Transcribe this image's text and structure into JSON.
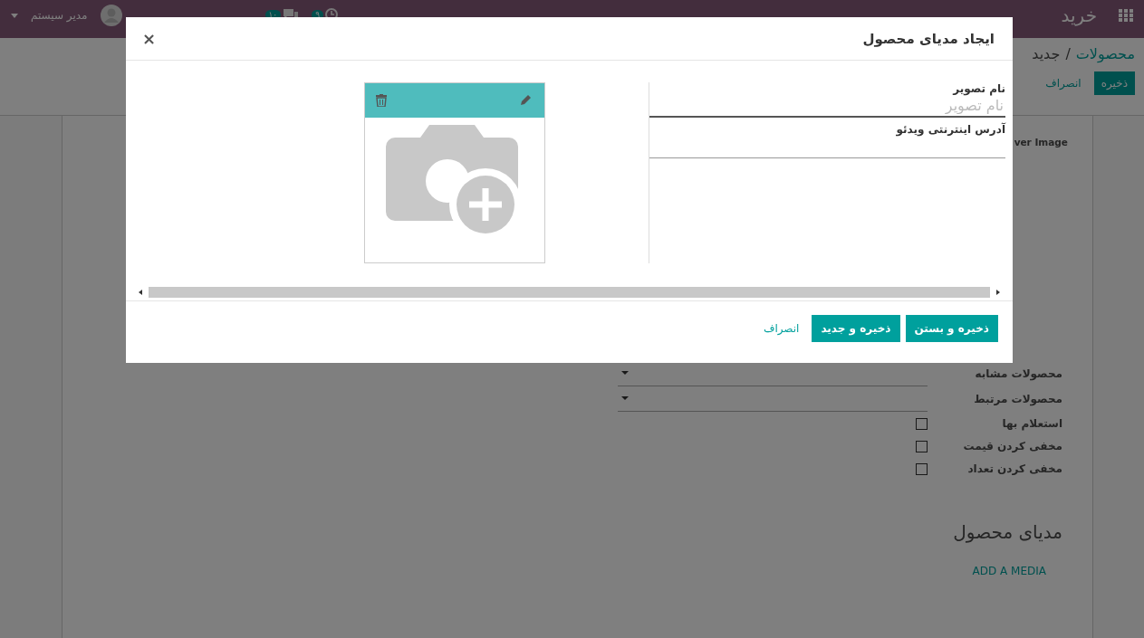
{
  "navbar": {
    "app_name": "خرید",
    "activities_badge": "۹",
    "messages_badge": "۱۰",
    "user": "مدیر سیستم"
  },
  "breadcrumb": {
    "parent": "محصولات",
    "separator": "/",
    "current": "جدید"
  },
  "control_buttons": [
    {
      "label": "ذخیره",
      "kind": "primary"
    },
    {
      "label": "انصراف",
      "kind": "link"
    }
  ],
  "form": {
    "cut_label": "ver Image",
    "fields": [
      {
        "label": "محصولات مشابه",
        "kind": "select"
      },
      {
        "label": "محصولات مرتبط",
        "kind": "select"
      },
      {
        "label": "استعلام بها",
        "kind": "checkbox",
        "checked": false
      },
      {
        "label": "مخفی کردن قیمت",
        "kind": "checkbox",
        "checked": false
      },
      {
        "label": "مخفی کردن تعداد",
        "kind": "checkbox",
        "checked": false
      }
    ],
    "media_heading": "مدیای محصول",
    "add_media": "ADD A MEDIA"
  },
  "dialog": {
    "title": "ایجاد مدیای محصول",
    "close": "×",
    "fields": [
      {
        "label": "نام تصویر",
        "placeholder": "نام تصویر"
      },
      {
        "label": "آدرس اینترنتی ویدئو"
      }
    ],
    "buttons": [
      {
        "label": "ذخیره و بستن",
        "kind": "primary"
      },
      {
        "label": "ذخیره و جدید",
        "kind": "primary"
      },
      {
        "label": "انصراف",
        "kind": "link"
      }
    ]
  }
}
